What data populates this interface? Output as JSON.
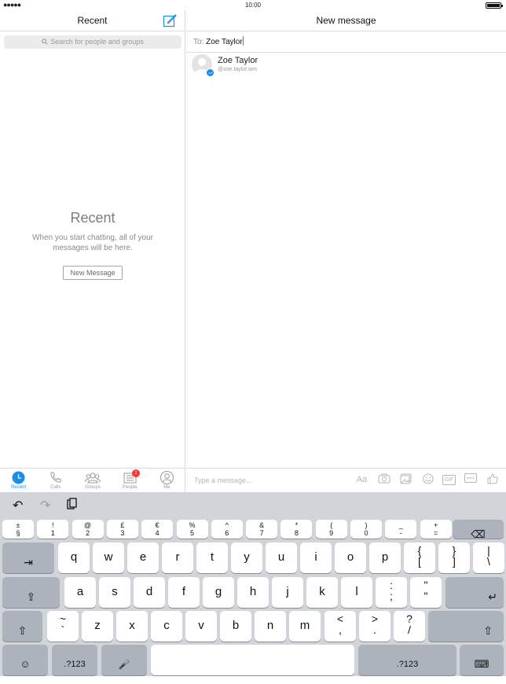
{
  "status": {
    "time": "10:00",
    "signal": "●●●●●"
  },
  "left_pane": {
    "title": "Recent",
    "search_placeholder": "Search for people and groups",
    "empty_title": "Recent",
    "empty_desc": "When you start chatting, all of your messages will be here.",
    "new_message_button": "New Message",
    "tabs": [
      {
        "label": "Recent",
        "icon": "clock-icon",
        "active": true
      },
      {
        "label": "Calls",
        "icon": "phone-icon"
      },
      {
        "label": "Groups",
        "icon": "groups-icon"
      },
      {
        "label": "People",
        "icon": "people-icon",
        "badge": "1"
      },
      {
        "label": "Me",
        "icon": "me-icon"
      }
    ]
  },
  "right_pane": {
    "title": "New message",
    "to_label": "To:",
    "to_value": "Zoe Taylor",
    "result": {
      "name": "Zoe Taylor",
      "handle": "@zoe.taylor.wm"
    },
    "composer_placeholder": "Type a message...",
    "composer_icons": {
      "text": "Aa",
      "gif": "GIF"
    }
  },
  "keyboard": {
    "num_row": [
      [
        "±",
        "§"
      ],
      [
        "!",
        "1"
      ],
      [
        "@",
        "2"
      ],
      [
        "£",
        "3"
      ],
      [
        "€",
        "4"
      ],
      [
        "%",
        "5"
      ],
      [
        "^",
        "6"
      ],
      [
        "&",
        "7"
      ],
      [
        "*",
        "8"
      ],
      [
        "(",
        "9"
      ],
      [
        ")",
        "0"
      ],
      [
        "_",
        "-"
      ],
      [
        "+",
        "="
      ]
    ],
    "row1": [
      "q",
      "w",
      "e",
      "r",
      "t",
      "y",
      "u",
      "i",
      "o",
      "p"
    ],
    "row1_extra": [
      [
        "{",
        "["
      ],
      [
        "}",
        "]"
      ],
      [
        "|",
        "\\"
      ]
    ],
    "row2": [
      "a",
      "s",
      "d",
      "f",
      "g",
      "h",
      "j",
      "k",
      "l"
    ],
    "row2_extra": [
      [
        ":",
        ";"
      ],
      [
        "\"",
        "\""
      ]
    ],
    "row3": [
      "z",
      "x",
      "c",
      "v",
      "b",
      "n",
      "m"
    ],
    "row3_extra": [
      [
        "~",
        "`"
      ],
      [
        "<",
        ","
      ],
      [
        ">",
        "."
      ],
      [
        "?",
        "/"
      ]
    ],
    "mode_label": ".?123",
    "mode_label_right": ".?123"
  },
  "colors": {
    "accent": "#1d8de8",
    "badge": "#ff3333"
  }
}
